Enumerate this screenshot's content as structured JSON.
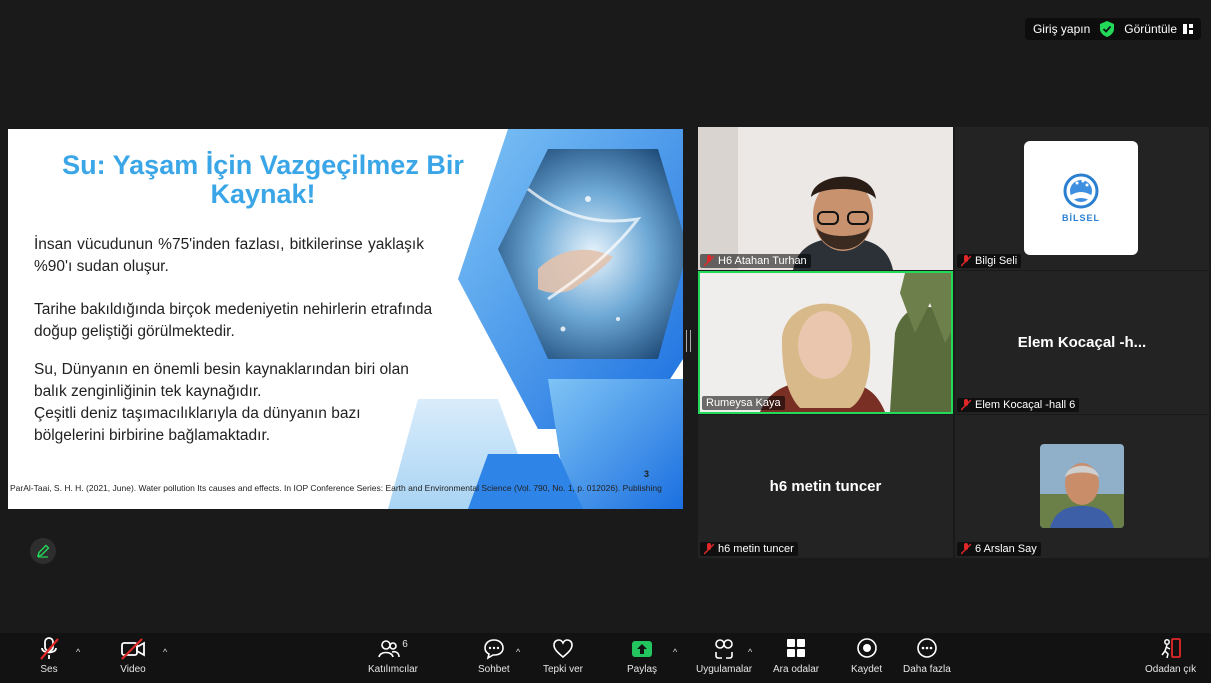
{
  "topbar": {
    "signin_label": "Giriş yapın",
    "view_label": "Görüntüle"
  },
  "slide": {
    "title_line1": "Su: Yaşam İçin Vazgeçilmez Bir",
    "title_line2": "Kaynak!",
    "p1": "İnsan vücudunun %75'inden fazlası, bitkilerinse yaklaşık %90'ı sudan oluşur.",
    "p2": "Tarihe bakıldığında birçok medeniyetin nehirlerin etrafında doğup geliştiği görülmektedir.",
    "p3": "Su, Dünyanın en önemli besin kaynaklarından biri olan balık zenginliğinin tek kaynağıdır.",
    "p4": "Çeşitli deniz taşımacılıklarıyla da dünyanın bazı bölgelerini birbirine bağlamaktadır.",
    "page_number": "3",
    "citation": "ParAl-Taai, S. H. H. (2021, June). Water pollution Its causes and effects. In IOP Conference Series: Earth and Environmental Science (Vol. 790, No. 1, p. 012026). Publishing"
  },
  "participants": [
    {
      "name": "H6 Atahan Turhan",
      "muted": true
    },
    {
      "name": "Bilgi Seli",
      "muted": true,
      "logo_text": "BİLSEL"
    },
    {
      "name": "Rumeysa Kaya",
      "muted": false,
      "active_speaker": true
    },
    {
      "name": "Elem Kocaçal -hall 6",
      "muted": true,
      "display_title": "Elem Kocaçal -h..."
    },
    {
      "name": "h6 metin tuncer",
      "muted": true,
      "display_title": "h6 metin tuncer"
    },
    {
      "name": "6 Arslan Say",
      "muted": true
    }
  ],
  "toolbar": {
    "audio": "Ses",
    "video": "Video",
    "participants": "Katılımcılar",
    "participants_count": "6",
    "chat": "Sohbet",
    "react": "Tepki ver",
    "share": "Paylaş",
    "apps": "Uygulamalar",
    "breakout": "Ara odalar",
    "record": "Kaydet",
    "more": "Daha fazla",
    "leave": "Odadan çık"
  },
  "colors": {
    "accent_green": "#23d959",
    "slide_blue": "#3aa6e8",
    "leave_red": "#e02828",
    "share_green": "#22c55e"
  }
}
